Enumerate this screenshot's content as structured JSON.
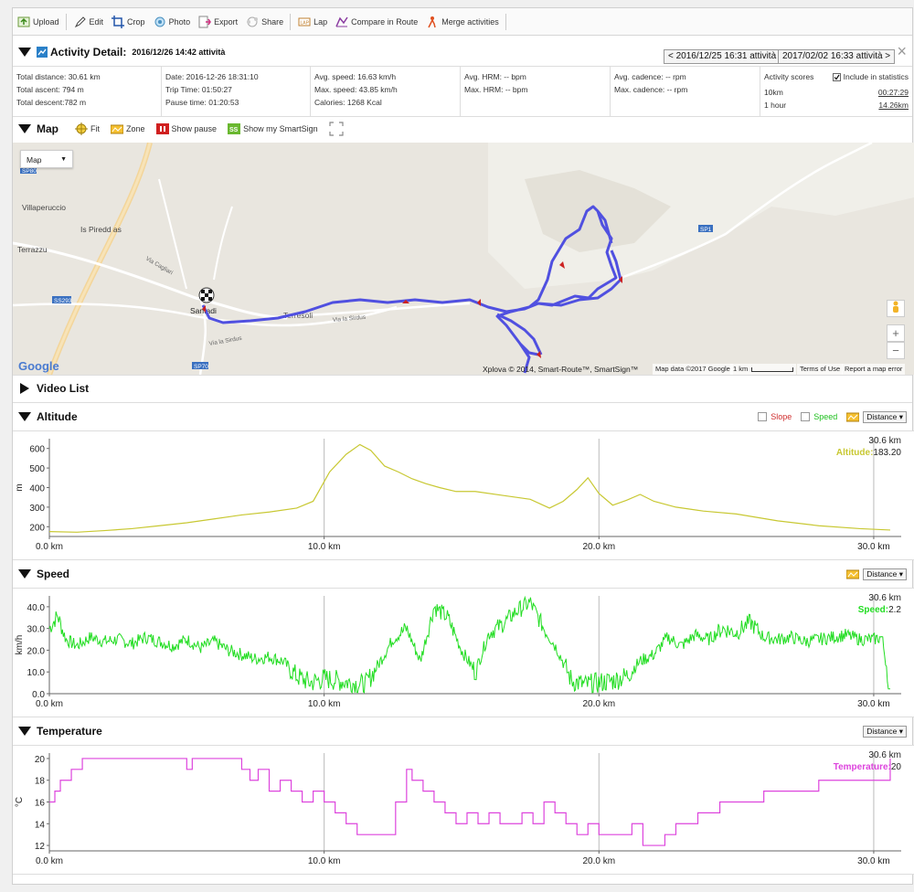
{
  "toolbar": {
    "items": [
      {
        "label": "Upload",
        "icon": "upload-icon"
      },
      {
        "label": "Edit",
        "icon": "edit-icon"
      },
      {
        "label": "Crop",
        "icon": "crop-icon"
      },
      {
        "label": "Photo",
        "icon": "photo-icon"
      },
      {
        "label": "Export",
        "icon": "export-icon"
      },
      {
        "label": "Share",
        "icon": "share-icon"
      },
      {
        "label": "Lap",
        "icon": "lap-icon"
      },
      {
        "label": "Compare in Route",
        "icon": "compare-icon"
      },
      {
        "label": "Merge activities",
        "icon": "merge-icon"
      }
    ]
  },
  "detail": {
    "title": "Activity Detail:",
    "date": "2016/12/26 14:42 attività",
    "prev": "< 2016/12/25 16:31 attività",
    "next": "2017/02/02 16:33 attività >",
    "close": "×"
  },
  "stats": {
    "col1": [
      "Total distance: 30.61 km",
      "Total ascent: 794 m",
      "Total descent:782 m"
    ],
    "col2": [
      "Date: 2016-12-26 18:31:10",
      "Trip Time: 01:50:27",
      "Pause time: 01:20:53"
    ],
    "col3": [
      "Avg. speed: 16.63 km/h",
      "Max. speed: 43.85 km/h",
      "Calories: 1268 Kcal"
    ],
    "col4": [
      "Avg. HRM: -- bpm",
      "Max. HRM: -- bpm"
    ],
    "col5": [
      "Avg. cadence: -- rpm",
      "Max. cadence: -- rpm"
    ],
    "scores": {
      "title": "Activity scores",
      "include": "Include in statistics",
      "rows": [
        {
          "label": "10km",
          "value": "00:27:29"
        },
        {
          "label": "1 hour",
          "value": "14.26km"
        }
      ]
    }
  },
  "map_section": {
    "title": "Map",
    "controls": [
      {
        "label": "Fit",
        "icon": "fit-icon"
      },
      {
        "label": "Zone",
        "icon": "zone-icon"
      },
      {
        "label": "Show pause",
        "icon": "pause-icon"
      },
      {
        "label": "Show my SmartSign",
        "icon": "smartsign-icon"
      }
    ],
    "map_type": "Map",
    "places": [
      {
        "name": "Villaperuccio"
      },
      {
        "name": "Is Piredd as"
      },
      {
        "name": "Terrazzu"
      },
      {
        "name": "Terresoli"
      },
      {
        "name": "Santadi"
      },
      {
        "name": "Via Cagliari"
      },
      {
        "name": "Via la Sirdus"
      },
      {
        "name": "Via la Sirdus"
      }
    ],
    "road_labels": [
      "SS293",
      "SP70",
      "SP1",
      "SP80"
    ],
    "google": "Google",
    "attribution": "Xplova © 2014, Smart-Route™, SmartSign™",
    "map_data": "Map data ©2017 Google",
    "scale": "1 km",
    "terms": "Terms of Use",
    "report": "Report a map error",
    "colors": {
      "track": "#5050e0",
      "marker": "#cc2222"
    }
  },
  "video": {
    "title": "Video List"
  },
  "altitude": {
    "title": "Altitude",
    "slope": "Slope",
    "speed": "Speed",
    "unit": "Distance",
    "dist_readout": "30.6 km",
    "value_label": "Altitude:",
    "value": "183.20",
    "color": "#c8c832"
  },
  "speed_chart": {
    "title": "Speed",
    "unit": "Distance",
    "dist_readout": "30.6 km",
    "value_label": "Speed:",
    "value": "2.2",
    "color": "#22dd22"
  },
  "temperature": {
    "title": "Temperature",
    "unit": "Distance",
    "dist_readout": "30.6 km",
    "value_label": "Temperature:",
    "value": "20",
    "color": "#dd44dd"
  },
  "chart_data": [
    {
      "type": "line",
      "xlabel": "",
      "ylabel": "m",
      "xlim": [
        0,
        31
      ],
      "ylim": [
        150,
        650
      ],
      "yticks": [
        200,
        300,
        400,
        500,
        600
      ],
      "xticks": [
        0,
        10,
        20,
        30
      ],
      "xtick_labels": [
        "0.0 km",
        "10.0 km",
        "20.0 km",
        "30.0 km"
      ],
      "x": [
        0,
        1,
        2,
        3,
        4,
        5,
        6,
        7,
        8,
        9,
        9.6,
        10.2,
        10.8,
        11.3,
        11.7,
        12.2,
        12.7,
        13.2,
        13.7,
        14.2,
        14.8,
        15.5,
        16.5,
        17.5,
        18.2,
        18.7,
        19.2,
        19.6,
        20.0,
        20.5,
        21.0,
        21.5,
        22.0,
        22.8,
        23.8,
        25,
        26.5,
        28,
        29.5,
        30.6
      ],
      "y": [
        175,
        172,
        180,
        190,
        205,
        220,
        240,
        260,
        275,
        295,
        330,
        480,
        570,
        620,
        590,
        510,
        480,
        445,
        420,
        400,
        380,
        380,
        360,
        340,
        295,
        330,
        390,
        450,
        370,
        310,
        335,
        365,
        330,
        300,
        280,
        265,
        230,
        205,
        190,
        183
      ],
      "series": [
        {
          "values": []
        }
      ]
    },
    {
      "type": "line",
      "xlabel": "",
      "ylabel": "km/h",
      "xlim": [
        0,
        31
      ],
      "ylim": [
        0,
        45
      ],
      "yticks": [
        0,
        10,
        20,
        30,
        40
      ],
      "ytick_labels": [
        "0.0",
        "10.0",
        "20.0",
        "30.0",
        "40.0"
      ],
      "xticks": [
        0,
        10,
        20,
        30
      ],
      "xtick_labels": [
        "0.0 km",
        "10.0 km",
        "20.0 km",
        "30.0 km"
      ],
      "x": [
        0,
        0.3,
        0.6,
        1,
        1.5,
        2,
        2.5,
        3,
        3.5,
        4,
        4.5,
        5,
        5.5,
        6,
        6.5,
        7,
        7.5,
        8,
        8.5,
        9,
        9.5,
        10,
        10.5,
        11,
        11.5,
        12,
        12.5,
        13,
        13.5,
        14,
        14.5,
        15,
        15.5,
        16,
        16.5,
        17,
        17.5,
        18,
        18.5,
        19,
        19.5,
        20,
        20.5,
        21,
        21.5,
        22,
        22.5,
        23,
        23.5,
        24,
        24.5,
        25,
        25.5,
        26,
        26.5,
        27,
        27.5,
        28,
        28.5,
        29,
        29.5,
        30,
        30.3,
        30.6
      ],
      "y": [
        30,
        36,
        25,
        22,
        26,
        24,
        25,
        23,
        26,
        24,
        22,
        25,
        21,
        24,
        20,
        18,
        16,
        17,
        15,
        8,
        5,
        7,
        6,
        5,
        4,
        14,
        25,
        30,
        15,
        40,
        35,
        20,
        10,
        28,
        32,
        38,
        42,
        30,
        20,
        6,
        4,
        5,
        6,
        8,
        15,
        18,
        26,
        22,
        27,
        25,
        30,
        28,
        33,
        26,
        25,
        26,
        24,
        25,
        26,
        27,
        25,
        25,
        26,
        2.2
      ],
      "series": [
        {
          "values": []
        }
      ]
    },
    {
      "type": "line",
      "xlabel": "",
      "ylabel": "°C",
      "xlim": [
        0,
        31
      ],
      "ylim": [
        11.5,
        20.5
      ],
      "yticks": [
        12,
        14,
        16,
        18,
        20
      ],
      "xticks": [
        0,
        10,
        20,
        30
      ],
      "xtick_labels": [
        "0.0 km",
        "10.0 km",
        "20.0 km",
        "30.0 km"
      ],
      "x": [
        0,
        0.2,
        0.4,
        0.8,
        1.2,
        2,
        3,
        4,
        5,
        5.2,
        5.6,
        6,
        7,
        7.3,
        7.6,
        8,
        8.4,
        8.8,
        9.2,
        9.6,
        10,
        10.4,
        10.8,
        11.2,
        11.5,
        11.8,
        12.2,
        12.6,
        13,
        13.2,
        13.6,
        14,
        14.4,
        14.8,
        15.2,
        15.6,
        16,
        16.4,
        16.8,
        17.2,
        17.6,
        18,
        18.4,
        18.8,
        19.2,
        19.6,
        20,
        20.4,
        20.8,
        21.2,
        21.6,
        22,
        22.4,
        22.8,
        23.2,
        23.6,
        24,
        24.4,
        25,
        26,
        27,
        28,
        29,
        30,
        30.6
      ],
      "y": [
        16,
        17,
        18,
        19,
        20,
        20,
        20,
        20,
        19,
        20,
        20,
        20,
        19,
        18,
        19,
        17,
        18,
        17,
        16,
        17,
        16,
        15,
        14,
        13,
        13,
        13,
        13,
        16,
        19,
        18,
        17,
        16,
        15,
        14,
        15,
        14,
        15,
        14,
        14,
        15,
        14,
        16,
        15,
        14,
        13,
        14,
        13,
        13,
        13,
        14,
        12,
        12,
        13,
        14,
        14,
        15,
        15,
        16,
        16,
        17,
        17,
        18,
        18,
        18,
        20
      ],
      "series": [
        {
          "values": []
        }
      ]
    }
  ]
}
